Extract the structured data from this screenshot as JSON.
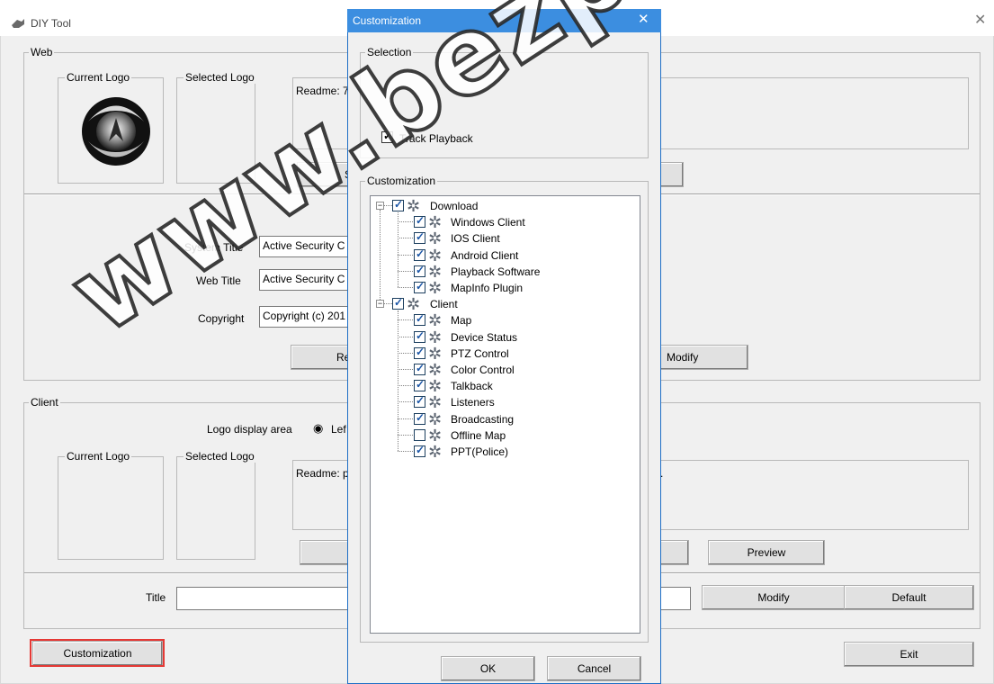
{
  "main": {
    "title": "DIY Tool",
    "web": {
      "legend": "Web",
      "current_logo_label": "Current Logo",
      "selected_logo_label": "Selected Logo",
      "readme": "Readme: 7",
      "select_button": "S",
      "system_title_label": "System Title",
      "system_title_value": "Active Security C",
      "web_title_label": "Web Title",
      "web_title_value": "Active Security C",
      "copyright_label": "Copyright",
      "copyright_value": "Copyright (c) 201",
      "reset_button": "Re",
      "modify_button": "Modify"
    },
    "client": {
      "legend": "Client",
      "logo_display_label": "Logo display area",
      "left_radio_label": "Lef",
      "current_logo_label": "Current Logo",
      "selected_logo_label": "Selected Logo",
      "readme": "Readme: p",
      "readme_tail": ".",
      "preview_button": "Preview",
      "title_label": "Title",
      "title_value": "",
      "modify_button": "Modify",
      "default_button": "Default"
    },
    "customization_button": "Customization",
    "exit_button": "Exit",
    "highlight_color": "#e53935"
  },
  "popup": {
    "title": "Customization",
    "close_glyph": "✕",
    "selection_legend": "Selection",
    "track_playback_label": "Track Playback",
    "track_playback_checked": true,
    "customization_legend": "Customization",
    "tree": [
      {
        "label": "Download",
        "checked": true,
        "expanded": true,
        "children": [
          {
            "label": "Windows Client",
            "checked": true
          },
          {
            "label": "IOS Client",
            "checked": true
          },
          {
            "label": "Android Client",
            "checked": true
          },
          {
            "label": "Playback Software",
            "checked": true
          },
          {
            "label": "MapInfo Plugin",
            "checked": true
          }
        ]
      },
      {
        "label": "Client",
        "checked": true,
        "expanded": true,
        "children": [
          {
            "label": "Map",
            "checked": true
          },
          {
            "label": "Device Status",
            "checked": true
          },
          {
            "label": "PTZ Control",
            "checked": true
          },
          {
            "label": "Color Control",
            "checked": true
          },
          {
            "label": "Talkback",
            "checked": true
          },
          {
            "label": "Listeners",
            "checked": true
          },
          {
            "label": "Broadcasting",
            "checked": true
          },
          {
            "label": "Offline Map",
            "checked": false
          },
          {
            "label": "PPT(Police)",
            "checked": true
          }
        ]
      }
    ],
    "ok_button": "OK",
    "cancel_button": "Cancel"
  },
  "watermark": "www.bezpeka"
}
